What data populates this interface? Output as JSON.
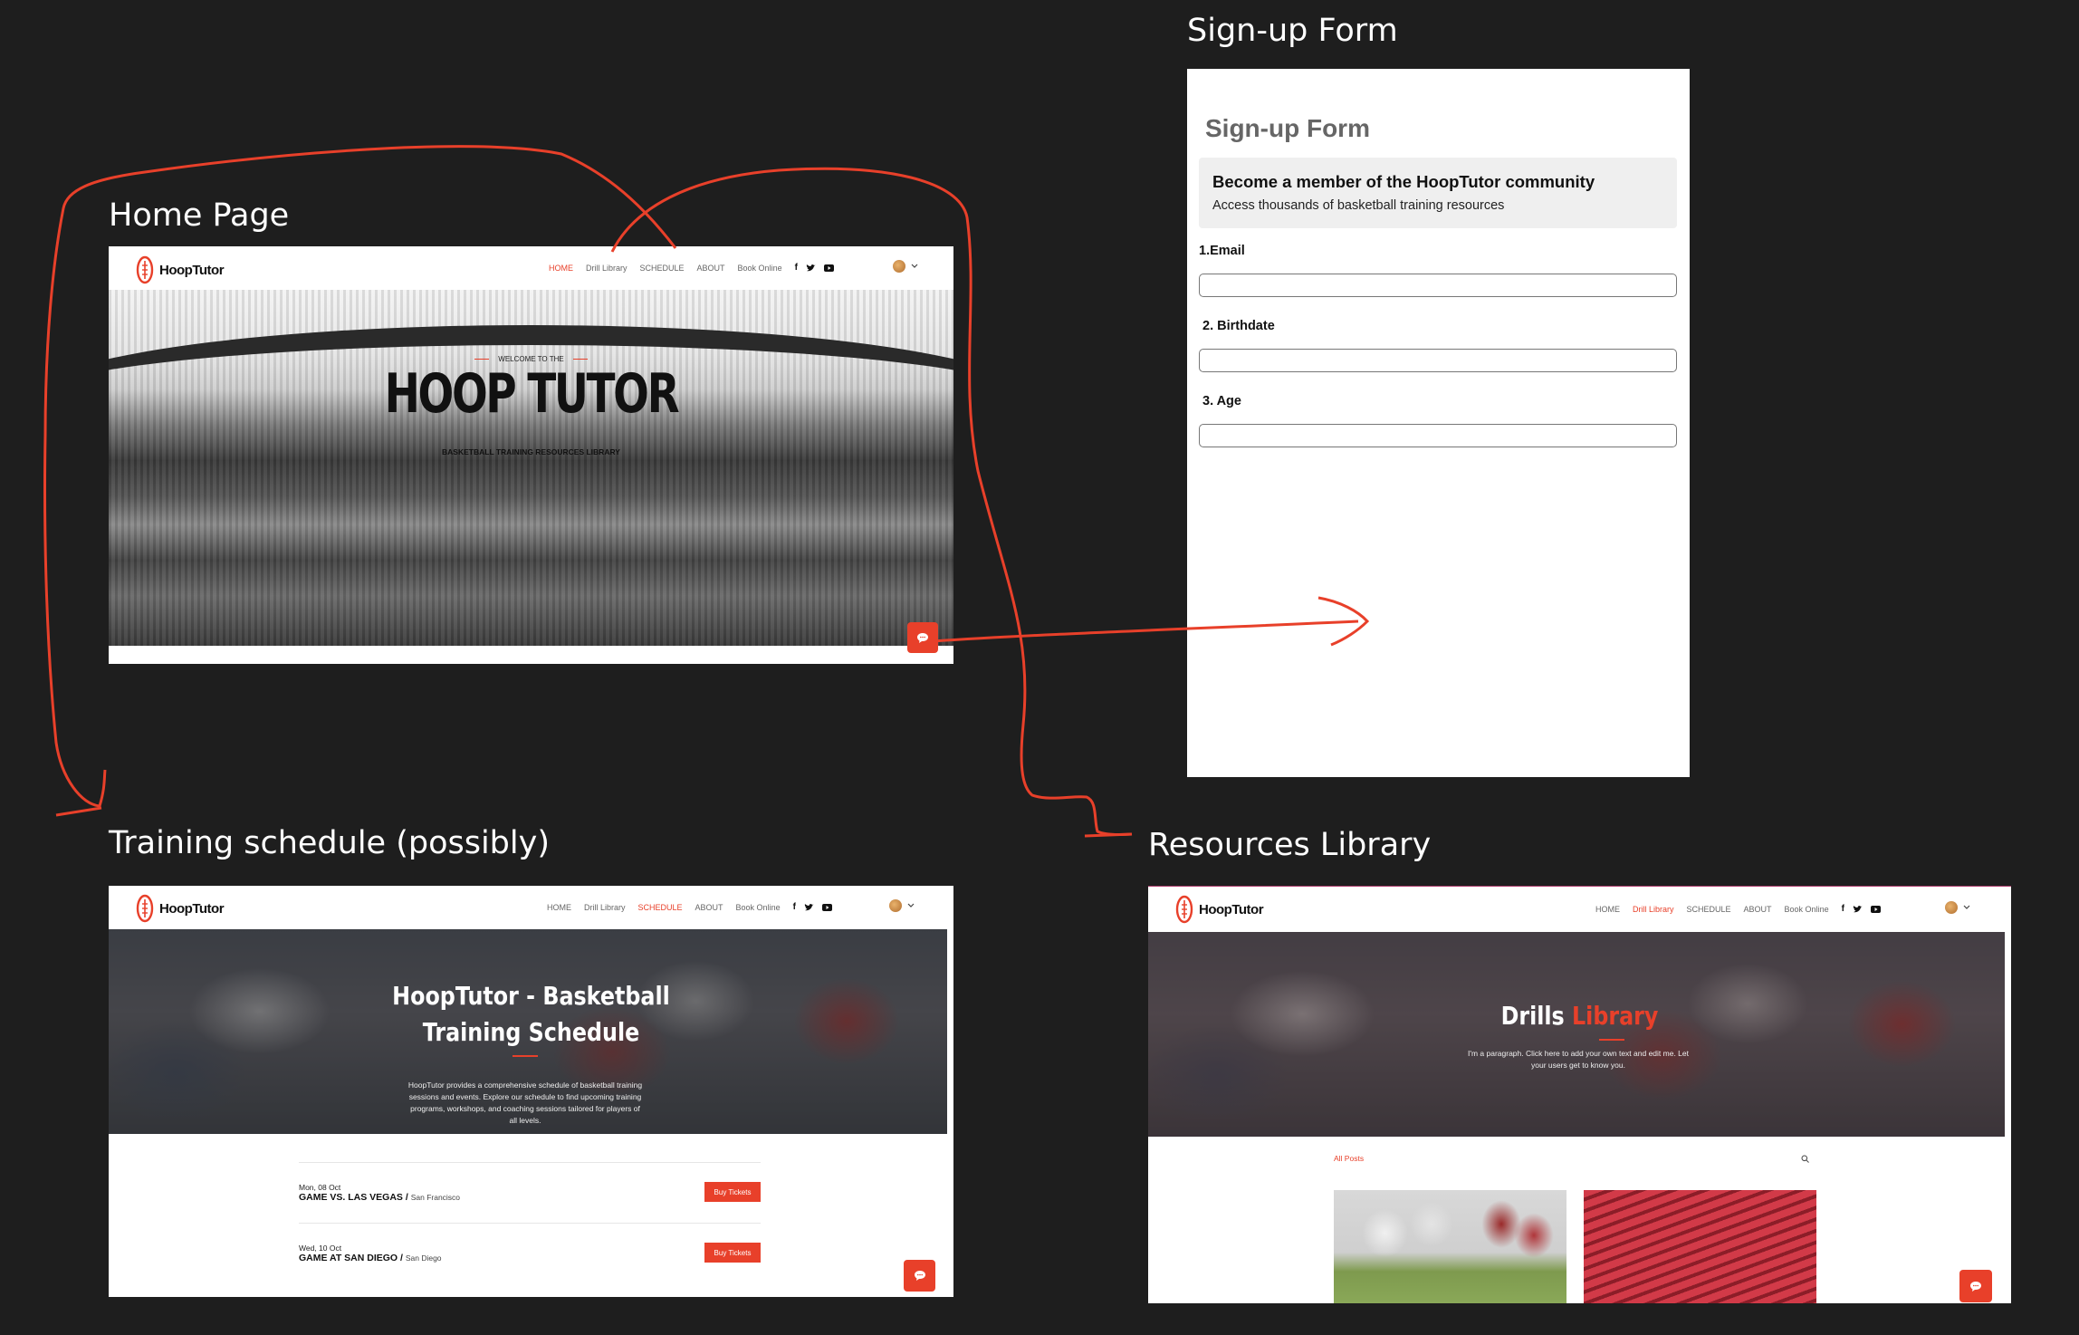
{
  "canvas": {
    "background": "#1e1e1e",
    "accent": "#e8402a"
  },
  "labels": {
    "home": "Home Page",
    "signup": "Sign-up Form",
    "schedule": "Training schedule (possibly)",
    "library": "Resources Library"
  },
  "site": {
    "brand": "HoopTutor",
    "menu": [
      "HOME",
      "Drill Library",
      "SCHEDULE",
      "ABOUT",
      "Book Online"
    ],
    "social_icons": [
      "facebook-icon",
      "twitter-icon",
      "youtube-icon"
    ],
    "chat_icon": "chat-icon"
  },
  "home": {
    "active_tab": "HOME",
    "welcome": "WELCOME TO THE",
    "title": "HOOP TUTOR",
    "subtitle": "BASKETBALL TRAINING RESOURCES LIBRARY"
  },
  "signup": {
    "title": "Sign-up Form",
    "box_heading": "Become a member of the HoopTutor community",
    "box_sub": "Access thousands of basketball training resources",
    "fields": [
      {
        "label": "1.Email",
        "value": ""
      },
      {
        "label": "2. Birthdate",
        "value": ""
      },
      {
        "label": "3. Age",
        "value": ""
      }
    ]
  },
  "schedule": {
    "active_tab": "SCHEDULE",
    "title_line1": "HoopTutor - Basketball",
    "title_line2": "Training Schedule",
    "description": "HoopTutor provides a comprehensive schedule of basketball training sessions and events. Explore our schedule to find upcoming training programs, workshops, and coaching sessions tailored for players of all levels.",
    "events": [
      {
        "date": "Mon, 08 Oct",
        "name": "GAME VS. LAS VEGAS / ",
        "location": "San Francisco",
        "button": "Buy Tickets"
      },
      {
        "date": "Wed, 10 Oct",
        "name": "GAME AT SAN DIEGO / ",
        "location": "San Diego",
        "button": "Buy Tickets"
      }
    ]
  },
  "library": {
    "active_tab": "Drill Library",
    "title_white": "Drills",
    "title_red": "Library",
    "paragraph": "I'm a paragraph. Click here to add your own text and edit me. Let your users get to know you.",
    "all_posts": "All Posts",
    "search_icon": "search-icon"
  }
}
